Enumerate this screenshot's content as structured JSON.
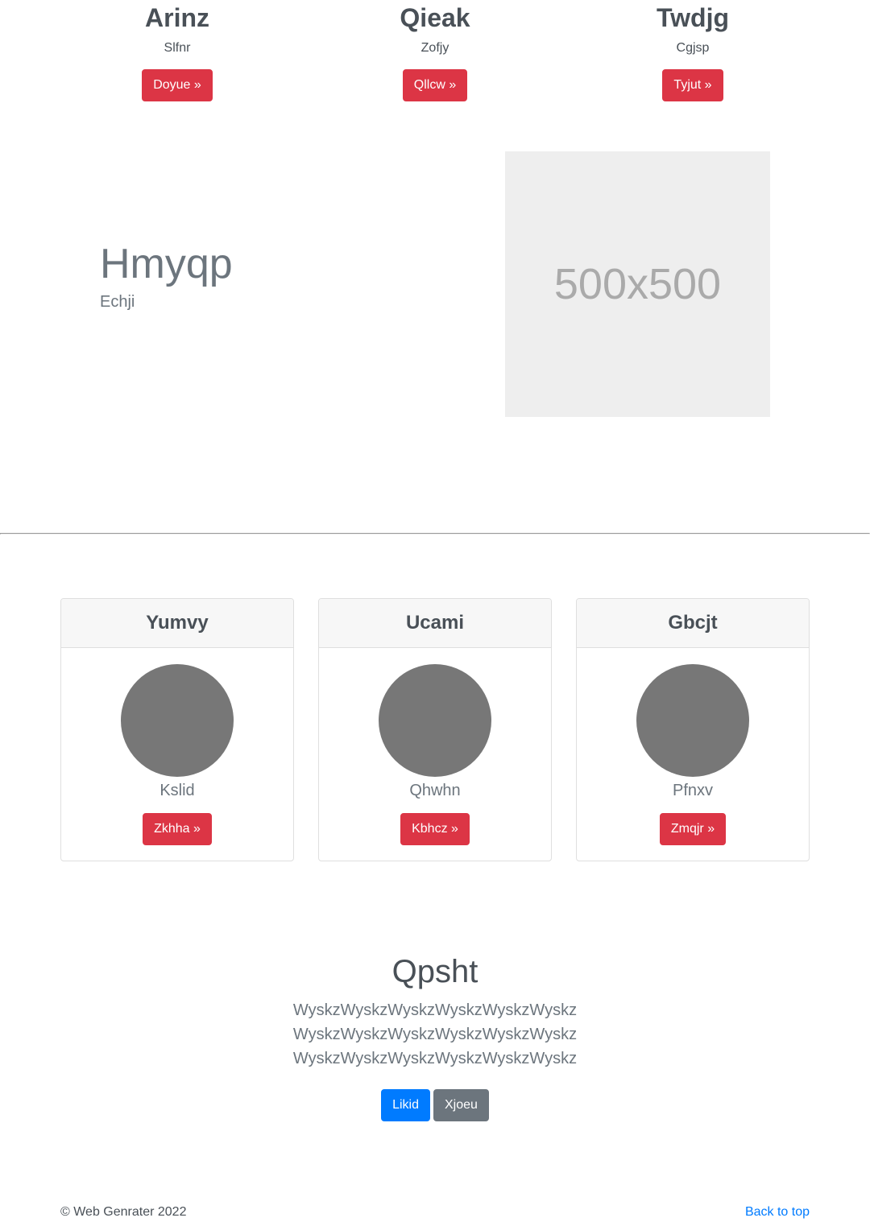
{
  "top_columns": [
    {
      "title": "Arinz",
      "subtitle": "Slfnr",
      "button_label": "Doyue »"
    },
    {
      "title": "Qieak",
      "subtitle": "Zofjy",
      "button_label": "Qllcw »"
    },
    {
      "title": "Twdjg",
      "subtitle": "Cgjsp",
      "button_label": "Tyjut »"
    }
  ],
  "feature": {
    "heading": "Hmyqp",
    "subheading": "Echji",
    "image_placeholder_text": "500x500"
  },
  "cards": [
    {
      "title": "Yumvy",
      "name": "Kslid",
      "button_label": "Zkhha »"
    },
    {
      "title": "Ucami",
      "name": "Qhwhn",
      "button_label": "Kbhcz »"
    },
    {
      "title": "Gbcjt",
      "name": "Pfnxv",
      "button_label": "Zmqjr »"
    }
  ],
  "jumbotron": {
    "title": "Qpsht",
    "lines": [
      "WyskzWyskzWyskzWyskzWyskzWyskz",
      "WyskzWyskzWyskzWyskzWyskzWyskz",
      "WyskzWyskzWyskzWyskzWyskzWyskz"
    ],
    "primary_button": "Likid",
    "secondary_button": "Xjoeu"
  },
  "footer": {
    "copyright": "© Web Genrater 2022",
    "back_to_top": "Back to top"
  },
  "colors": {
    "danger": "#dc3545",
    "primary": "#007bff",
    "secondary": "#6c757d",
    "avatar": "#777777",
    "placeholder_bg": "#eeeeee"
  }
}
